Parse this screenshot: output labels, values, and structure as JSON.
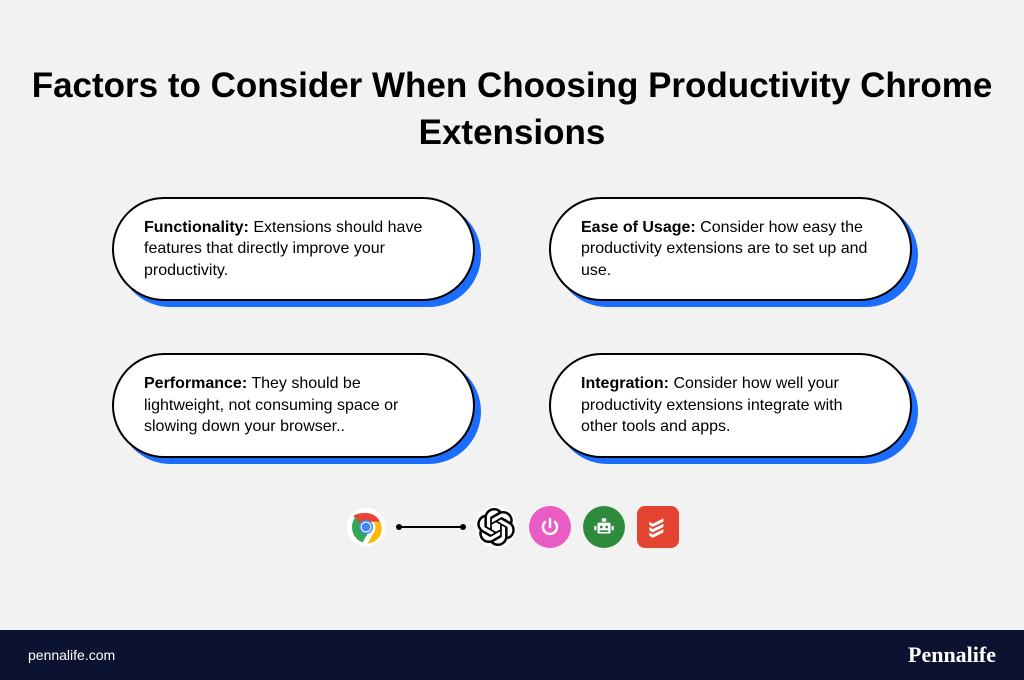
{
  "title": "Factors to Consider When Choosing Productivity Chrome Extensions",
  "cards": [
    {
      "label": "Functionality:",
      "desc": " Extensions should have features that directly improve your productivity."
    },
    {
      "label": "Ease of Usage:",
      "desc": " Consider how easy the productivity extensions are to set up and use."
    },
    {
      "label": "Performance:",
      "desc": " They should be lightweight, not consuming space or slowing down your browser.."
    },
    {
      "label": "Integration:",
      "desc": " Consider how well your productivity extensions integrate with other tools and apps."
    }
  ],
  "footer": {
    "url": "pennalife.com",
    "brand": "Pennalife"
  }
}
